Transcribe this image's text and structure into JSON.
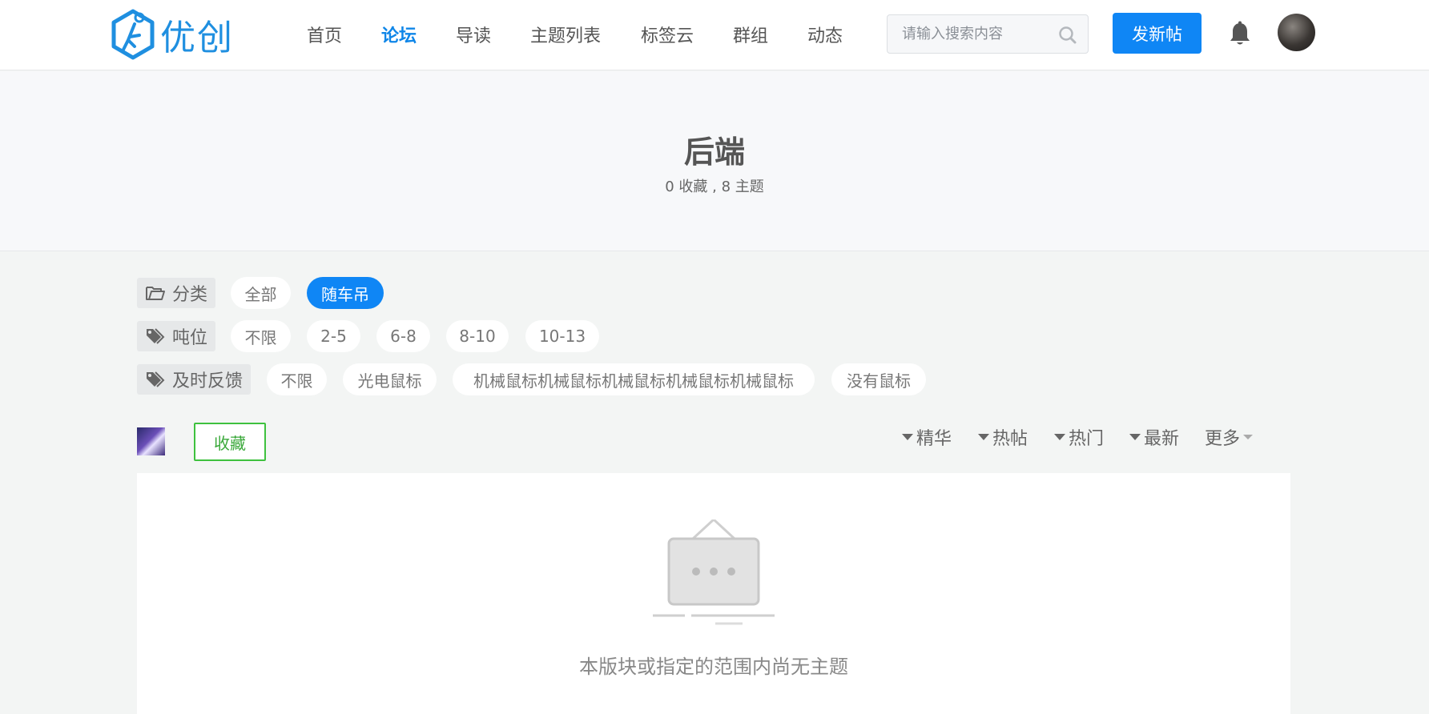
{
  "header": {
    "logo_text": "优创",
    "nav": [
      {
        "label": "首页",
        "active": false
      },
      {
        "label": "论坛",
        "active": true
      },
      {
        "label": "导读",
        "active": false
      },
      {
        "label": "主题列表",
        "active": false
      },
      {
        "label": "标签云",
        "active": false
      },
      {
        "label": "群组",
        "active": false
      },
      {
        "label": "动态",
        "active": false
      }
    ],
    "search_placeholder": "请输入搜索内容",
    "post_button": "发新帖",
    "icons": {
      "search": "search-icon",
      "bell": "bell-icon"
    }
  },
  "banner": {
    "title": "后端",
    "stats": "0 收藏 , 8 主题"
  },
  "filters": {
    "category": {
      "label": "分类",
      "options": [
        "全部",
        "随车吊"
      ],
      "active": "随车吊"
    },
    "tonnage": {
      "label": "吨位",
      "options": [
        "不限",
        "2-5",
        "6-8",
        "8-10",
        "10-13"
      ]
    },
    "feedback": {
      "label": "及时反馈",
      "options": [
        "不限",
        "光电鼠标",
        "机械鼠标机械鼠标机械鼠标机械鼠标机械鼠标",
        "没有鼠标"
      ]
    }
  },
  "toolbar": {
    "favorite_button": "收藏",
    "sorts": [
      "精华",
      "热帖",
      "热门",
      "最新"
    ],
    "more": "更多"
  },
  "empty": {
    "message": "本版块或指定的范围内尚无主题"
  },
  "colors": {
    "primary": "#0f86f5",
    "nav_active": "#0f86e8",
    "favorite": "#3ec13e",
    "logo": "#1f8fe0"
  }
}
